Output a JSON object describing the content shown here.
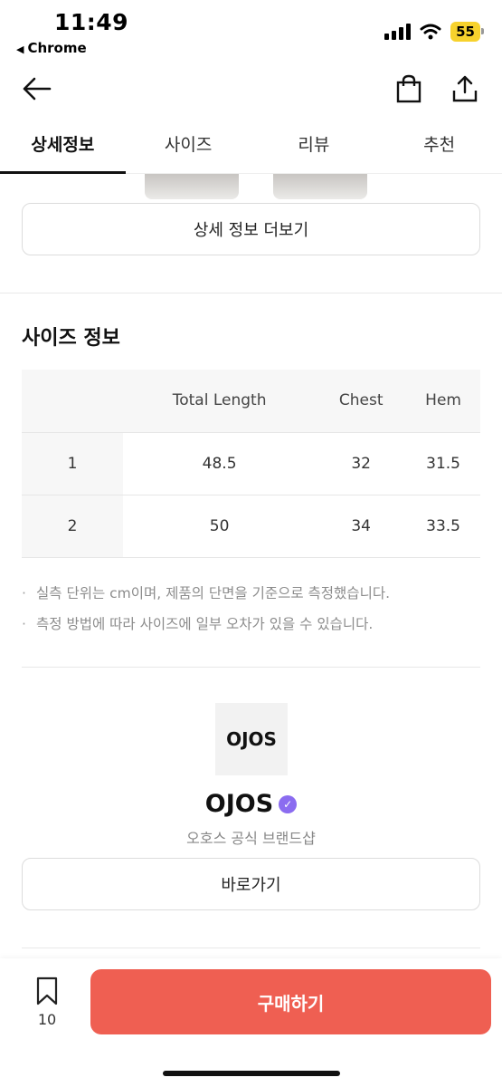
{
  "status_bar": {
    "time": "11:49",
    "back_app": "Chrome",
    "battery": "55"
  },
  "header": {
    "back_icon": "arrow-left-icon",
    "bag_icon": "shopping-bag-icon",
    "share_icon": "share-icon"
  },
  "tabs": [
    {
      "label": "상세정보",
      "active": true
    },
    {
      "label": "사이즈",
      "active": false
    },
    {
      "label": "리뷰",
      "active": false
    },
    {
      "label": "추천",
      "active": false
    }
  ],
  "detail": {
    "more_button": "상세 정보 더보기"
  },
  "size_info": {
    "title": "사이즈 정보",
    "columns": [
      "",
      "Total Length",
      "Chest",
      "Hem"
    ],
    "rows": [
      [
        "1",
        "48.5",
        "32",
        "31.5"
      ],
      [
        "2",
        "50",
        "34",
        "33.5"
      ]
    ],
    "notes": [
      "실측 단위는 cm이며, 제품의 단면을 기준으로 측정했습니다.",
      "측정 방법에 따라 사이즈에 일부 오차가 있을 수 있습니다."
    ]
  },
  "brand": {
    "logo_text": "OJOS",
    "name": "OJOS",
    "subtitle": "오호스 공식 브랜드샵",
    "go_button": "바로가기",
    "verified_color": "#8b6cf0"
  },
  "bottom_bar": {
    "bookmark_count": "10",
    "buy_button": "구매하기",
    "buy_color": "#ef5f52"
  }
}
